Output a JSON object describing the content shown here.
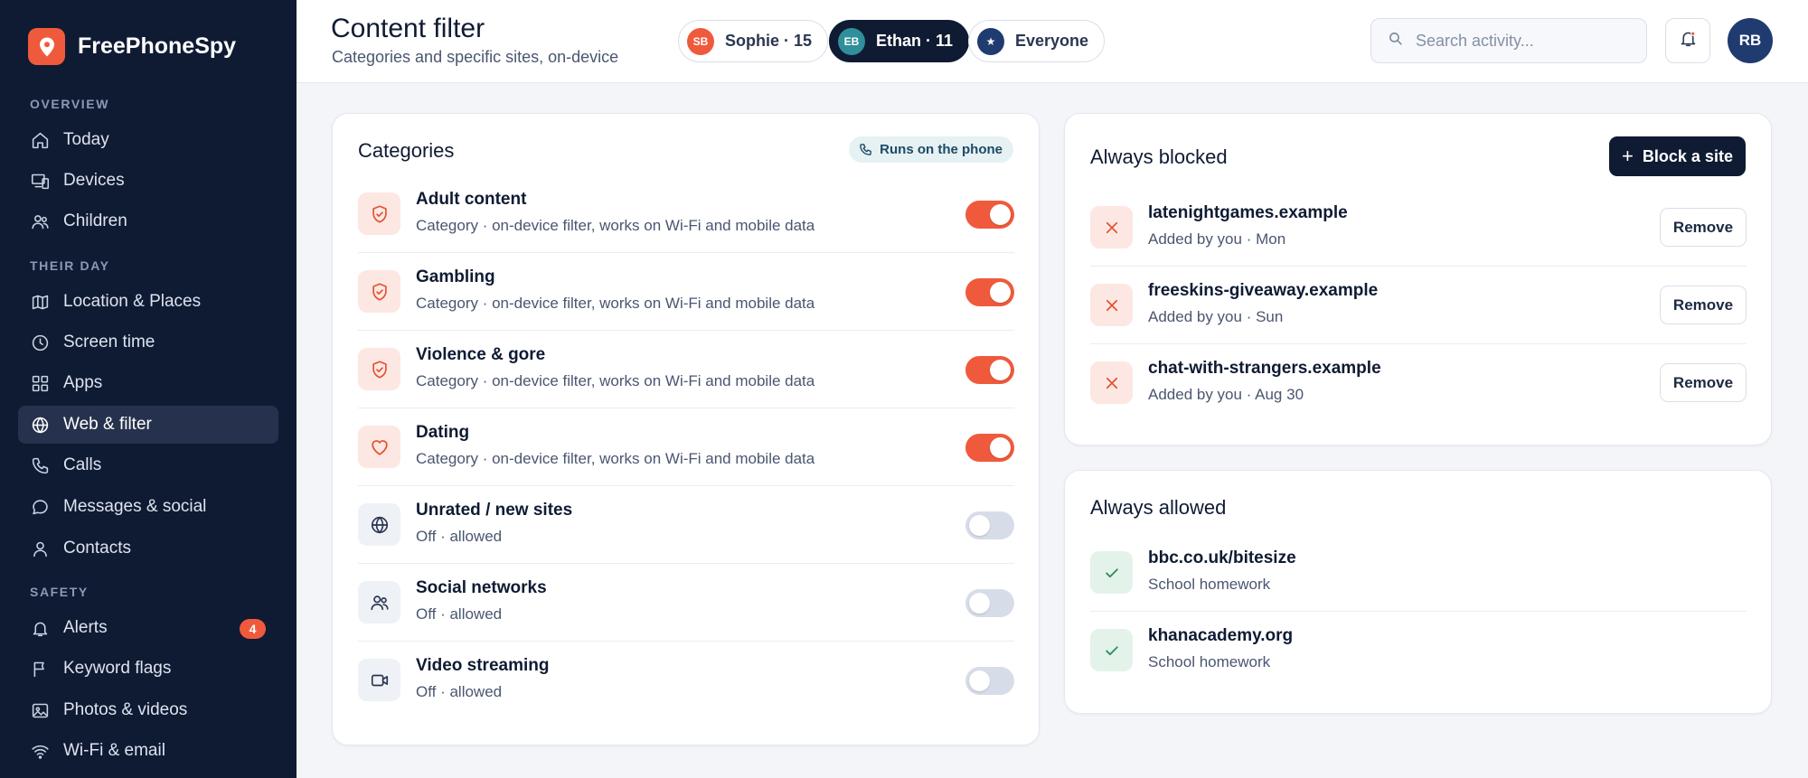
{
  "app": {
    "name": "FreePhoneSpy"
  },
  "sidebar": {
    "sections": [
      {
        "label": "OVERVIEW"
      },
      {
        "label": "THEIR DAY"
      },
      {
        "label": "SAFETY"
      }
    ],
    "items": [
      {
        "label": "Today",
        "icon": "home-icon"
      },
      {
        "label": "Devices",
        "icon": "devices-icon"
      },
      {
        "label": "Children",
        "icon": "users-icon"
      },
      {
        "label": "Location & Places",
        "icon": "map-icon"
      },
      {
        "label": "Screen time",
        "icon": "clock-icon"
      },
      {
        "label": "Apps",
        "icon": "grid-icon"
      },
      {
        "label": "Web & filter",
        "icon": "globe-icon",
        "active": true
      },
      {
        "label": "Calls",
        "icon": "phone-icon"
      },
      {
        "label": "Messages & social",
        "icon": "chat-icon"
      },
      {
        "label": "Contacts",
        "icon": "user-icon"
      },
      {
        "label": "Alerts",
        "icon": "bell-icon",
        "badge": "4"
      },
      {
        "label": "Keyword flags",
        "icon": "flag-icon"
      },
      {
        "label": "Photos & videos",
        "icon": "image-icon"
      },
      {
        "label": "Wi-Fi & email",
        "icon": "wifi-icon"
      }
    ]
  },
  "header": {
    "title": "Content filter",
    "subtitle": "Categories and specific sites, on-device",
    "children": [
      {
        "initials": "SB",
        "label": "Sophie · 15",
        "active": false
      },
      {
        "initials": "EB",
        "label": "Ethan · 11",
        "active": true
      },
      {
        "initials": "★",
        "label": "Everyone",
        "active": false
      }
    ],
    "search_placeholder": "Search activity...",
    "user_initials": "RB"
  },
  "categories": {
    "title": "Categories",
    "badge": "Runs on the phone",
    "items": [
      {
        "name": "Adult content",
        "desc": "Category · on-device filter, works on Wi-Fi and mobile data",
        "enabled": true,
        "icon": "shield-icon"
      },
      {
        "name": "Gambling",
        "desc": "Category · on-device filter, works on Wi-Fi and mobile data",
        "enabled": true,
        "icon": "shield-icon"
      },
      {
        "name": "Violence & gore",
        "desc": "Category · on-device filter, works on Wi-Fi and mobile data",
        "enabled": true,
        "icon": "shield-icon"
      },
      {
        "name": "Dating",
        "desc": "Category · on-device filter, works on Wi-Fi and mobile data",
        "enabled": true,
        "icon": "heart-icon"
      },
      {
        "name": "Unrated / new sites",
        "desc": "Off · allowed",
        "enabled": false,
        "icon": "globe-icon"
      },
      {
        "name": "Social networks",
        "desc": "Off · allowed",
        "enabled": false,
        "icon": "users-icon"
      },
      {
        "name": "Video streaming",
        "desc": "Off · allowed",
        "enabled": false,
        "icon": "video-icon"
      }
    ]
  },
  "blocked": {
    "title": "Always blocked",
    "add_label": "Block a site",
    "remove_label": "Remove",
    "items": [
      {
        "site": "latenightgames.example",
        "meta": "Added by you · Mon"
      },
      {
        "site": "freeskins-giveaway.example",
        "meta": "Added by you · Sun"
      },
      {
        "site": "chat-with-strangers.example",
        "meta": "Added by you · Aug 30"
      }
    ]
  },
  "allowed": {
    "title": "Always allowed",
    "items": [
      {
        "site": "bbc.co.uk/bitesize",
        "meta": "School homework"
      },
      {
        "site": "khanacademy.org",
        "meta": "School homework"
      }
    ]
  },
  "colors": {
    "sidebar_bg": "#0f1b33",
    "accent": "#f05a3c",
    "allowed": "#2f8f5b",
    "active_nav": "#26324d"
  }
}
